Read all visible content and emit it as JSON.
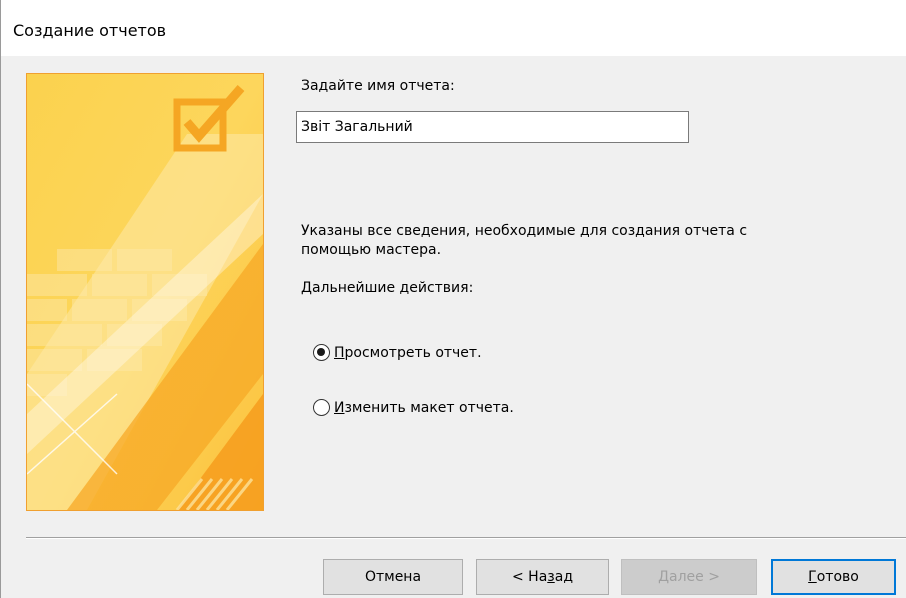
{
  "window": {
    "title": "Создание отчетов"
  },
  "form": {
    "name_label": "Задайте имя отчета:",
    "name_value": "Звіт Загальний",
    "info_line1": "Указаны все сведения, необходимые для создания отчета с",
    "info_line2": "помощью мастера.",
    "next_actions_label": "Дальнейшие действия:",
    "options": [
      {
        "hotkey": "П",
        "rest": "росмотреть отчет.",
        "selected": true
      },
      {
        "hotkey": "И",
        "rest": "зменить макет отчета.",
        "selected": false
      }
    ]
  },
  "buttons": {
    "cancel": "Отмена",
    "back_prefix": "< На",
    "back_hotkey": "з",
    "back_suffix": "ад",
    "next_hotkey": "Д",
    "next_suffix": "алее >",
    "finish_hotkey": "Г",
    "finish_suffix": "отово"
  },
  "colors": {
    "accent": "#0078d7",
    "art_orange": "#f7a825",
    "art_yellow": "#fde9a0"
  },
  "icons": {
    "illustration": "wizard-checkbox-illustration"
  }
}
